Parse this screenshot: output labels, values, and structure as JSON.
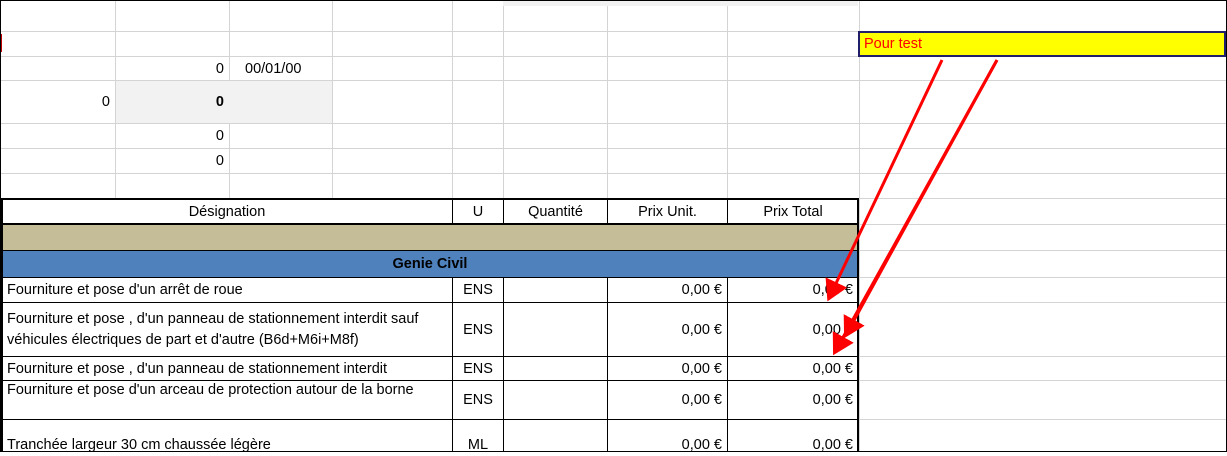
{
  "header_cells": {
    "row3_c2": "0",
    "row3_c3": "00/01/00",
    "row4_c1": "0",
    "row4_c2": "0",
    "row5_c2": "0",
    "row6_c2": "0"
  },
  "test_cell": {
    "text": "Pour test",
    "fill": "#ffff00",
    "text_color": "#ff0000",
    "border_color": "#1f1f6b"
  },
  "table": {
    "columns": [
      "Désignation",
      "U",
      "Quantité",
      "Prix Unit.",
      "Prix Total"
    ],
    "section_band_color": "#c5bd97",
    "section": {
      "title": "Genie Civil",
      "fill": "#4f81bd"
    },
    "rows": [
      {
        "designation": "Fourniture et pose d'un arrêt de roue",
        "unit": "ENS",
        "qty": "",
        "unit_price": "0,00 €",
        "total": "0,00 €"
      },
      {
        "designation": "Fourniture et pose , d'un panneau de stationnement interdit sauf véhicules électriques de part et d'autre (B6d+M6i+M8f)",
        "unit": "ENS",
        "qty": "",
        "unit_price": "0,00 €",
        "total": "0,00 €"
      },
      {
        "designation": "Fourniture et pose , d'un panneau de stationnement interdit",
        "unit": "ENS",
        "qty": "",
        "unit_price": "0,00 €",
        "total": "0,00 €"
      },
      {
        "designation": "Fourniture et pose d'un arceau de protection autour de la borne",
        "unit": "ENS",
        "qty": "",
        "unit_price": "0,00 €",
        "total": "0,00 €"
      },
      {
        "designation": "Tranchée largeur 30 cm chaussée légère",
        "unit": "ML",
        "qty": "",
        "unit_price": "0,00 €",
        "total": "0,00 €"
      }
    ]
  },
  "annotation": {
    "arrow_color": "#ff0000"
  }
}
